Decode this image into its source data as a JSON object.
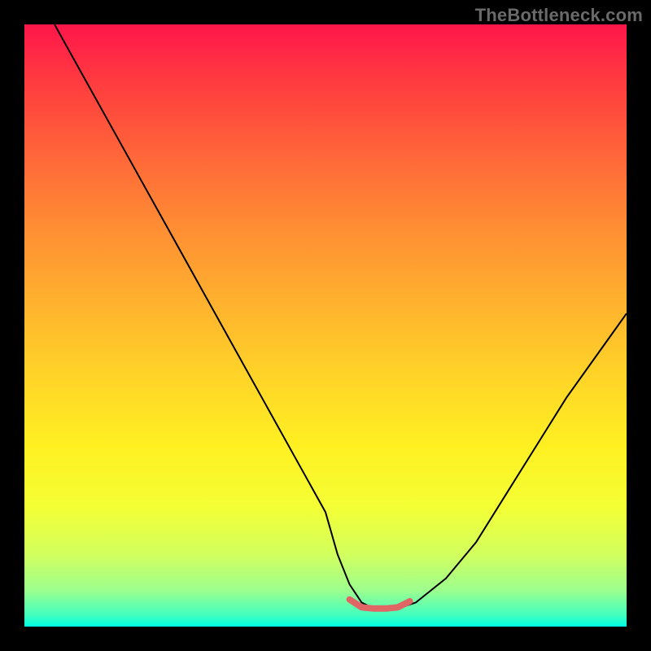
{
  "watermark": "TheBottleneck.com",
  "colors": {
    "background": "#000000",
    "curve": "#000000",
    "marker": "#e06666",
    "gradient_top": "#ff164a",
    "gradient_bottom": "#00ffe4"
  },
  "chart_data": {
    "type": "line",
    "title": "",
    "xlabel": "",
    "ylabel": "",
    "xlim": [
      0,
      100
    ],
    "ylim": [
      0,
      100
    ],
    "grid": false,
    "legend": false,
    "series": [
      {
        "name": "bottleneck-curve",
        "x": [
          5,
          10,
          15,
          20,
          25,
          30,
          35,
          40,
          45,
          50,
          52,
          54,
          56,
          58,
          60,
          62,
          65,
          70,
          75,
          80,
          85,
          90,
          95,
          100
        ],
        "y": [
          100,
          91,
          82,
          73,
          64,
          55,
          46,
          37,
          28,
          19,
          12,
          7,
          4,
          3,
          3,
          3,
          4,
          8,
          14,
          22,
          30,
          38,
          45,
          52
        ]
      }
    ],
    "annotations": [
      {
        "name": "flat-region",
        "x": [
          54,
          56,
          58,
          60,
          62,
          64
        ],
        "y": [
          4.5,
          3.2,
          3,
          3,
          3.2,
          4.2
        ]
      }
    ]
  }
}
